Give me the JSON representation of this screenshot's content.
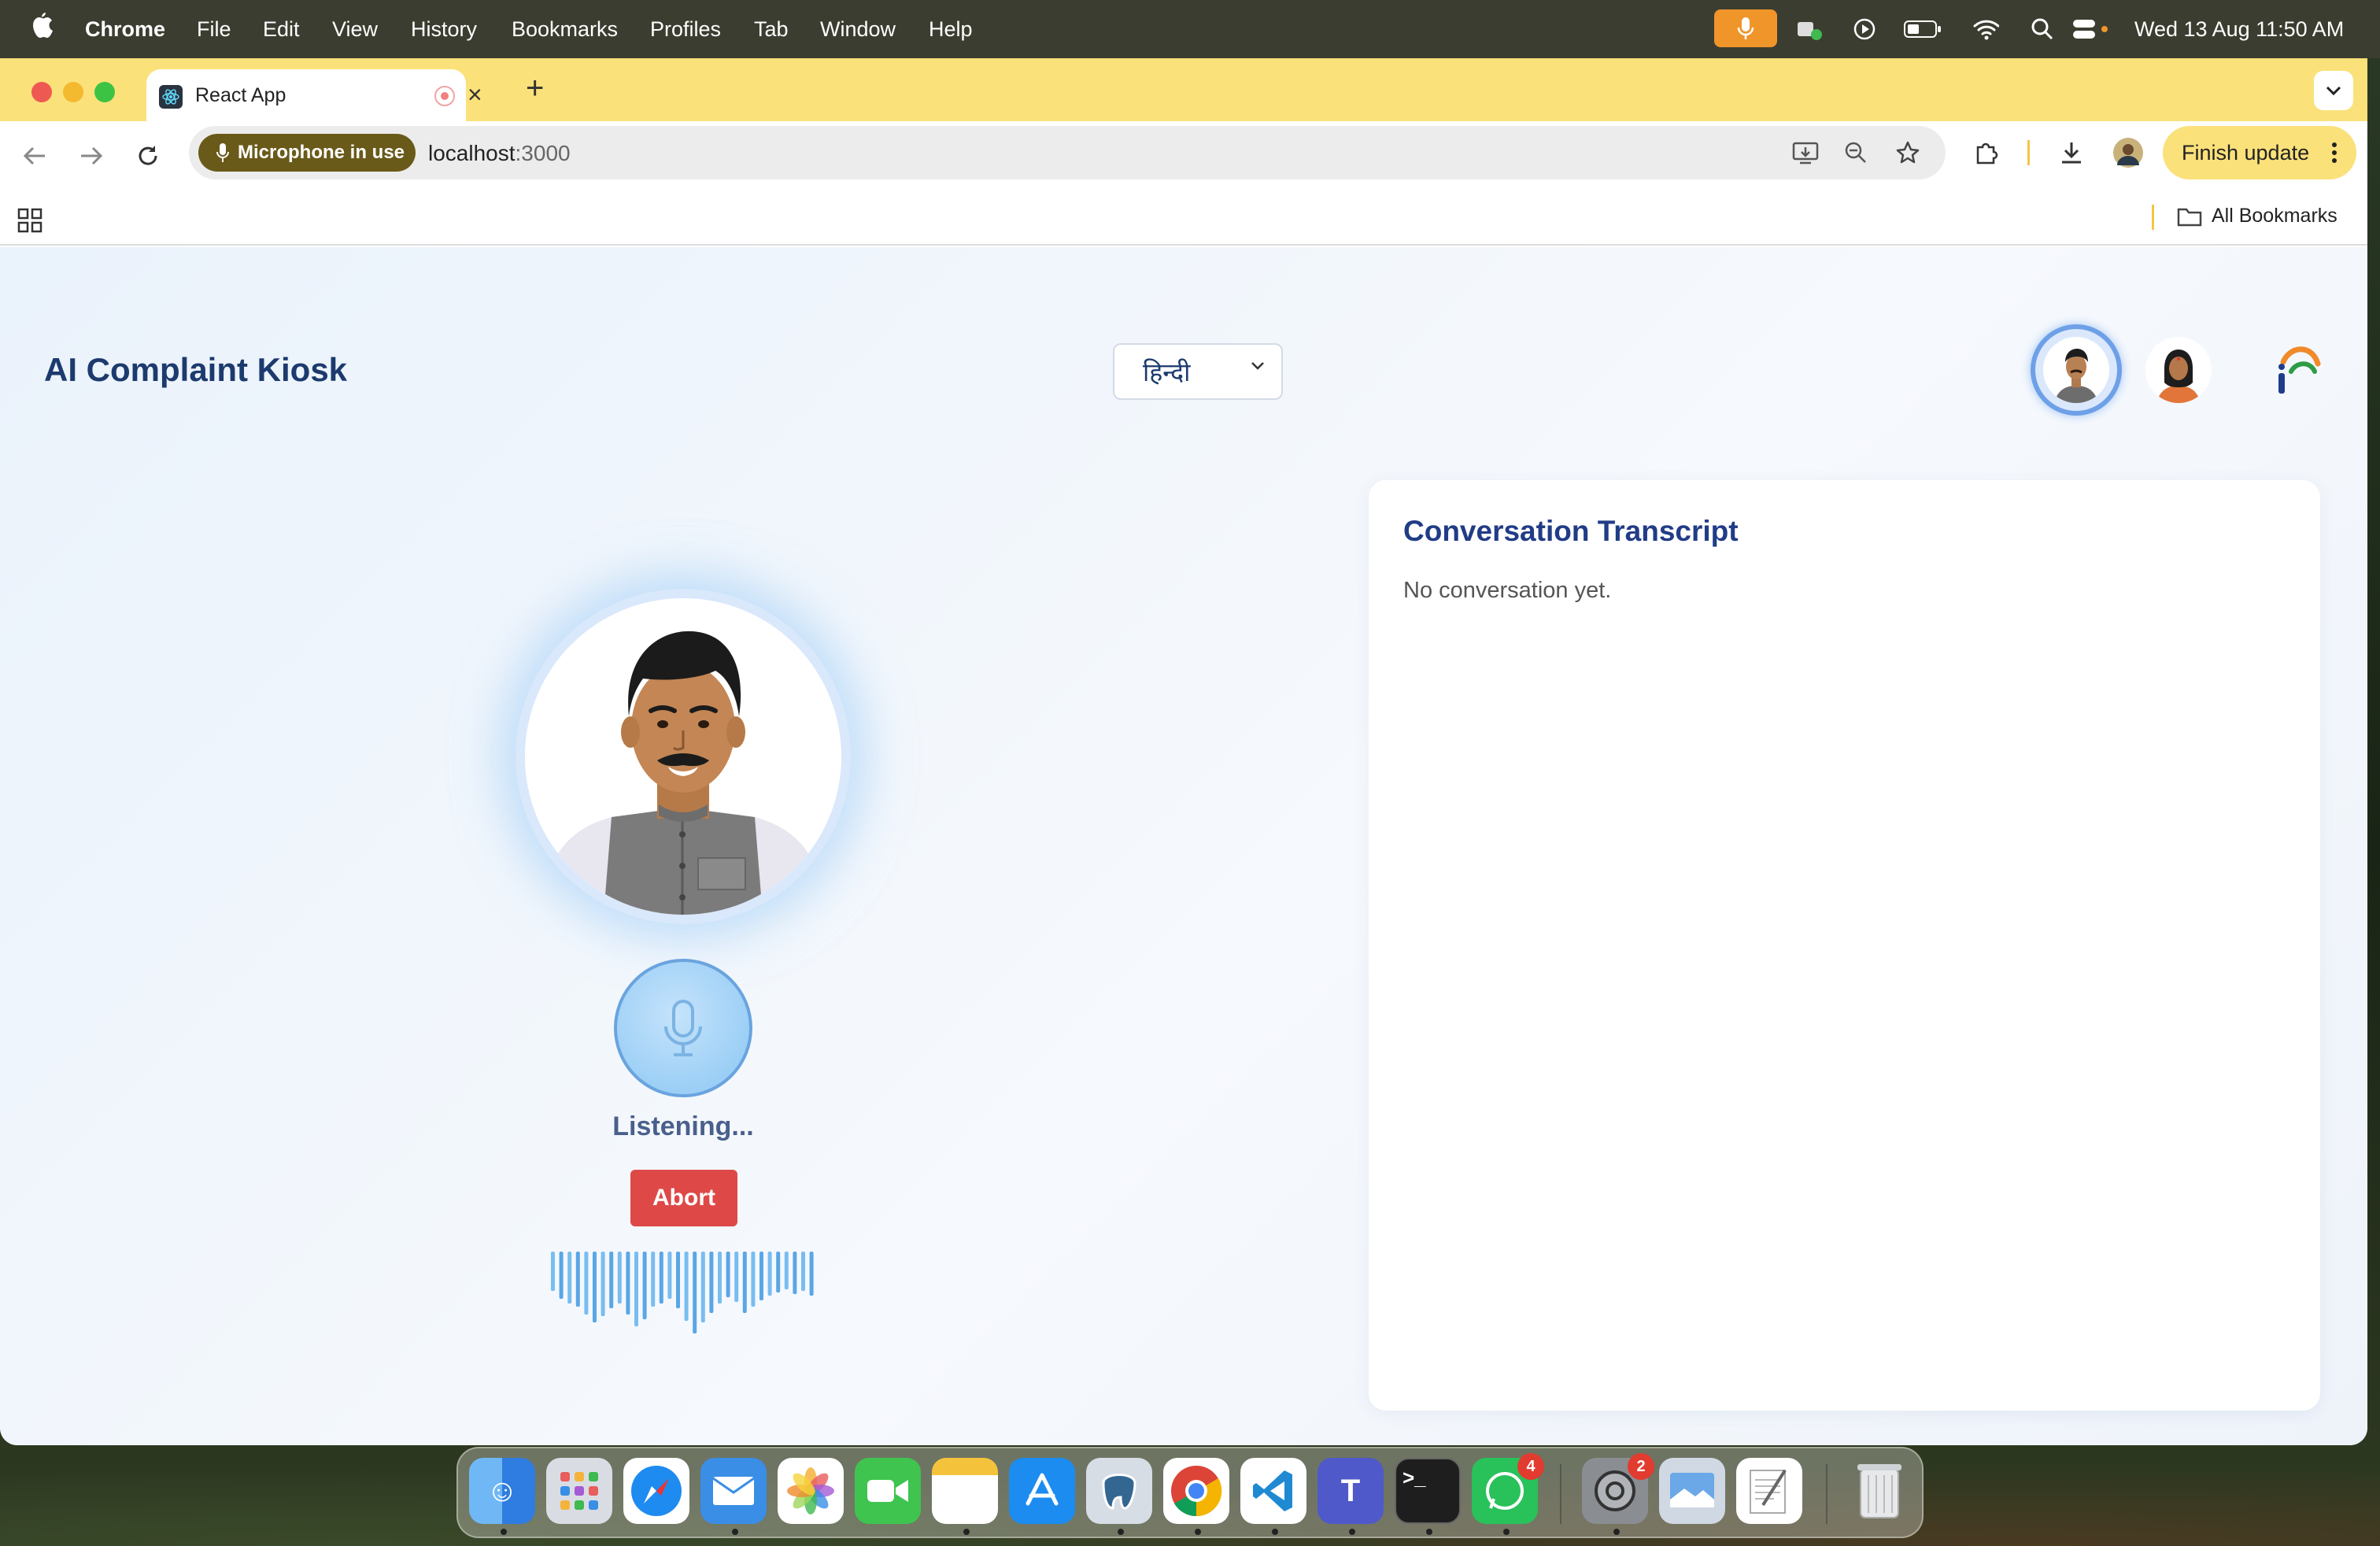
{
  "menubar": {
    "app_name": "Chrome",
    "menus": [
      "File",
      "Edit",
      "View",
      "History",
      "Bookmarks",
      "Profiles",
      "Tab",
      "Window",
      "Help"
    ],
    "datetime": "Wed 13 Aug  11:50 AM"
  },
  "browser": {
    "tab_title": "React App",
    "mic_badge": "Microphone in use",
    "url_host": "localhost",
    "url_port": ":3000",
    "finish_update": "Finish update",
    "all_bookmarks": "All Bookmarks"
  },
  "app": {
    "title": "AI Complaint Kiosk",
    "language_selected": "हिन्दी",
    "status_text": "Listening...",
    "abort_label": "Abort",
    "transcript_title": "Conversation Transcript",
    "transcript_empty": "No conversation yet.",
    "colors": {
      "accent": "#213c87",
      "abort": "#de4948",
      "mic": "#9ccff6"
    }
  },
  "dock": {
    "whatsapp_badge": "4",
    "settings_badge": "2"
  }
}
